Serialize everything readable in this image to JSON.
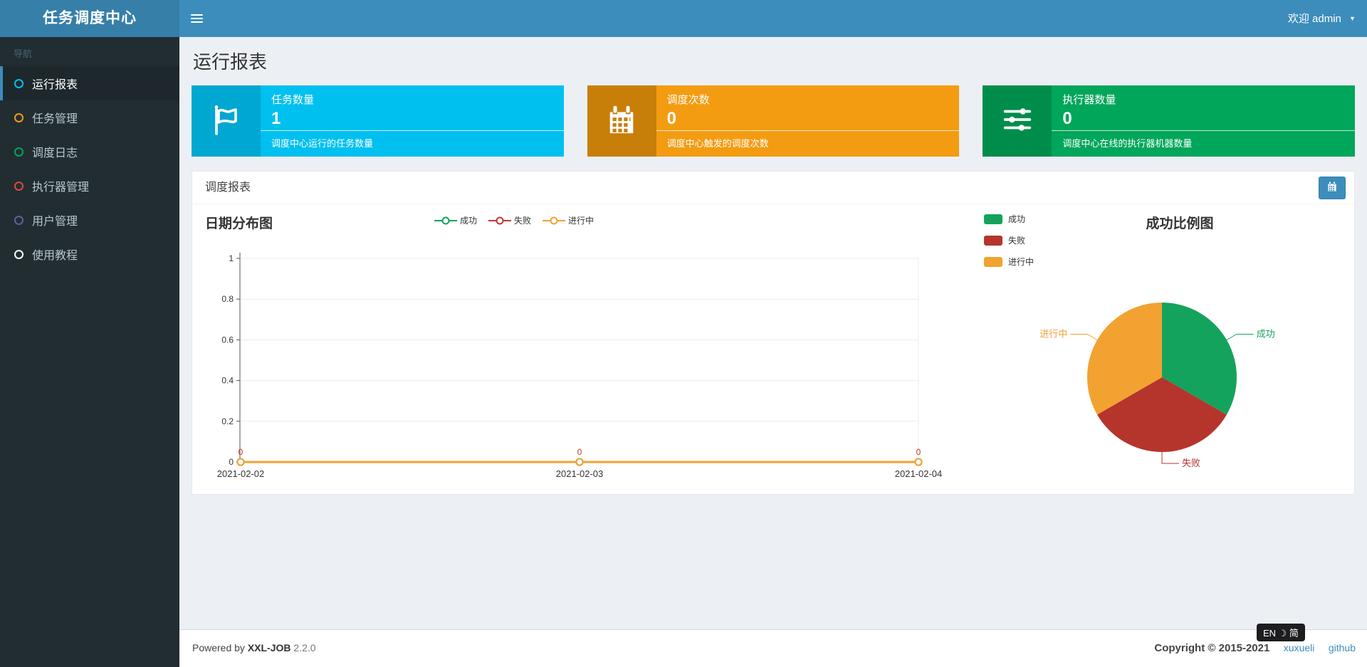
{
  "header": {
    "app_title": "任务调度中心",
    "welcome_text": "欢迎 admin",
    "icons": {
      "menu": "hamburger-icon",
      "user_caret": "caret-down-icon"
    }
  },
  "sidebar": {
    "nav_header": "导航",
    "items": [
      {
        "label": "运行报表",
        "icon": "circle-outline-icon",
        "color": "#00c0ef",
        "active": true
      },
      {
        "label": "任务管理",
        "icon": "circle-outline-icon",
        "color": "#f39c12",
        "active": false
      },
      {
        "label": "调度日志",
        "icon": "circle-outline-icon",
        "color": "#00a65a",
        "active": false
      },
      {
        "label": "执行器管理",
        "icon": "circle-outline-icon",
        "color": "#dd4b39",
        "active": false
      },
      {
        "label": "用户管理",
        "icon": "circle-outline-icon",
        "color": "#605ca8",
        "active": false
      },
      {
        "label": "使用教程",
        "icon": "circle-outline-icon",
        "color": "#ffffff",
        "active": false
      }
    ]
  },
  "page": {
    "title": "运行报表"
  },
  "stat_cards": [
    {
      "title": "任务数量",
      "value": "1",
      "desc": "调度中心运行的任务数量",
      "bg": "#00c0ef",
      "icon_bg": "#00a7d0",
      "icon": "flag-icon"
    },
    {
      "title": "调度次数",
      "value": "0",
      "desc": "调度中心触发的调度次数",
      "bg": "#f39c12",
      "icon_bg": "#c87f0a",
      "icon": "calendar-icon"
    },
    {
      "title": "执行器数量",
      "value": "0",
      "desc": "调度中心在线的执行器机器数量",
      "bg": "#00a65a",
      "icon_bg": "#008d4c",
      "icon": "sliders-icon"
    }
  ],
  "panel": {
    "title": "调度报表",
    "calendar_button_icon": "calendar-icon"
  },
  "chart_data": [
    {
      "type": "line",
      "title": "日期分布图",
      "categories": [
        "2021-02-02",
        "2021-02-03",
        "2021-02-04"
      ],
      "series": [
        {
          "name": "成功",
          "color": "#14a35c",
          "values": [
            0,
            0,
            0
          ]
        },
        {
          "name": "失败",
          "color": "#c23632",
          "values": [
            0,
            0,
            0
          ]
        },
        {
          "name": "进行中",
          "color": "#f1a231",
          "values": [
            0,
            0,
            0
          ]
        }
      ],
      "ylim": [
        0,
        1
      ],
      "yticks": [
        0,
        0.2,
        0.4,
        0.6,
        0.8,
        1
      ],
      "grid": true,
      "legend_position": "top-center",
      "point_labels": {
        "values": [
          "0",
          "0",
          "0"
        ],
        "color": "#c23632"
      }
    },
    {
      "type": "pie",
      "title": "成功比例图",
      "legend_position": "top-left",
      "slices": [
        {
          "name": "成功",
          "value": 33.3,
          "color": "#14a35c"
        },
        {
          "name": "失败",
          "value": 33.3,
          "color": "#b5352c"
        },
        {
          "name": "进行中",
          "value": 33.3,
          "color": "#f1a231"
        }
      ]
    }
  ],
  "footer": {
    "powered_prefix": "Powered by",
    "brand": "XXL-JOB",
    "version": "2.2.0",
    "copyright": "Copyright © 2015-2021",
    "links": [
      "xuxueli",
      "github"
    ]
  },
  "ime_badge": {
    "text": "EN ☽ 简"
  }
}
